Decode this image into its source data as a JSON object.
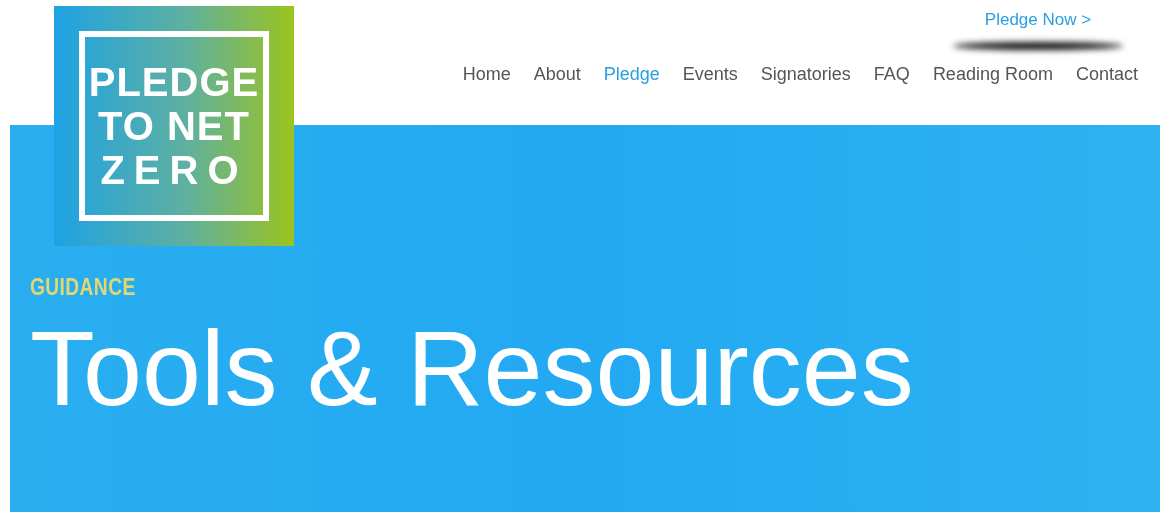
{
  "logo": {
    "lines": [
      "PLEDGE",
      "TO NET",
      "ZERO"
    ]
  },
  "cta": {
    "label": "Pledge Now >"
  },
  "nav": [
    {
      "label": "Home",
      "selected": false
    },
    {
      "label": "About",
      "selected": false
    },
    {
      "label": "Pledge",
      "selected": true
    },
    {
      "label": "Events",
      "selected": false
    },
    {
      "label": "Signatories",
      "selected": false
    },
    {
      "label": "FAQ",
      "selected": false
    },
    {
      "label": "Reading Room",
      "selected": false
    },
    {
      "label": "Contact",
      "selected": false
    }
  ],
  "hero": {
    "eyebrow": "GUIDANCE",
    "title": "Tools & Resources"
  }
}
